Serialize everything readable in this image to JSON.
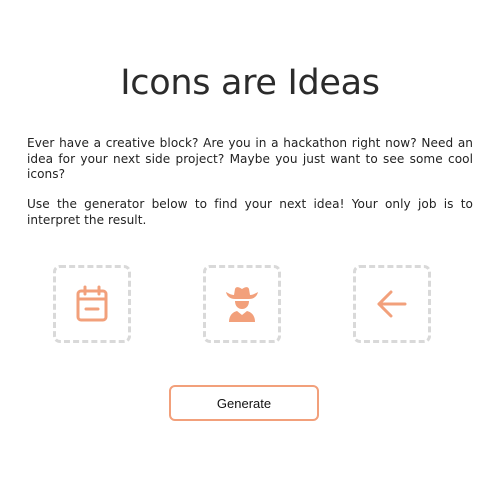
{
  "header": {
    "title": "Icons are Ideas"
  },
  "intro": {
    "paragraph_1": "Ever have a creative block? Are you in a hackathon right now? Need an idea for your next side project? Maybe you just want to see some cool icons?",
    "paragraph_2": "Use the generator below to find your next idea! Your only job is to interpret the result."
  },
  "icons": [
    {
      "name": "calendar-minus-icon"
    },
    {
      "name": "cowboy-icon"
    },
    {
      "name": "arrow-left-icon"
    }
  ],
  "generator": {
    "button_label": "Generate"
  },
  "colors": {
    "accent": "#f2a07b",
    "box_border": "#d9d9d9",
    "text": "#222222"
  }
}
